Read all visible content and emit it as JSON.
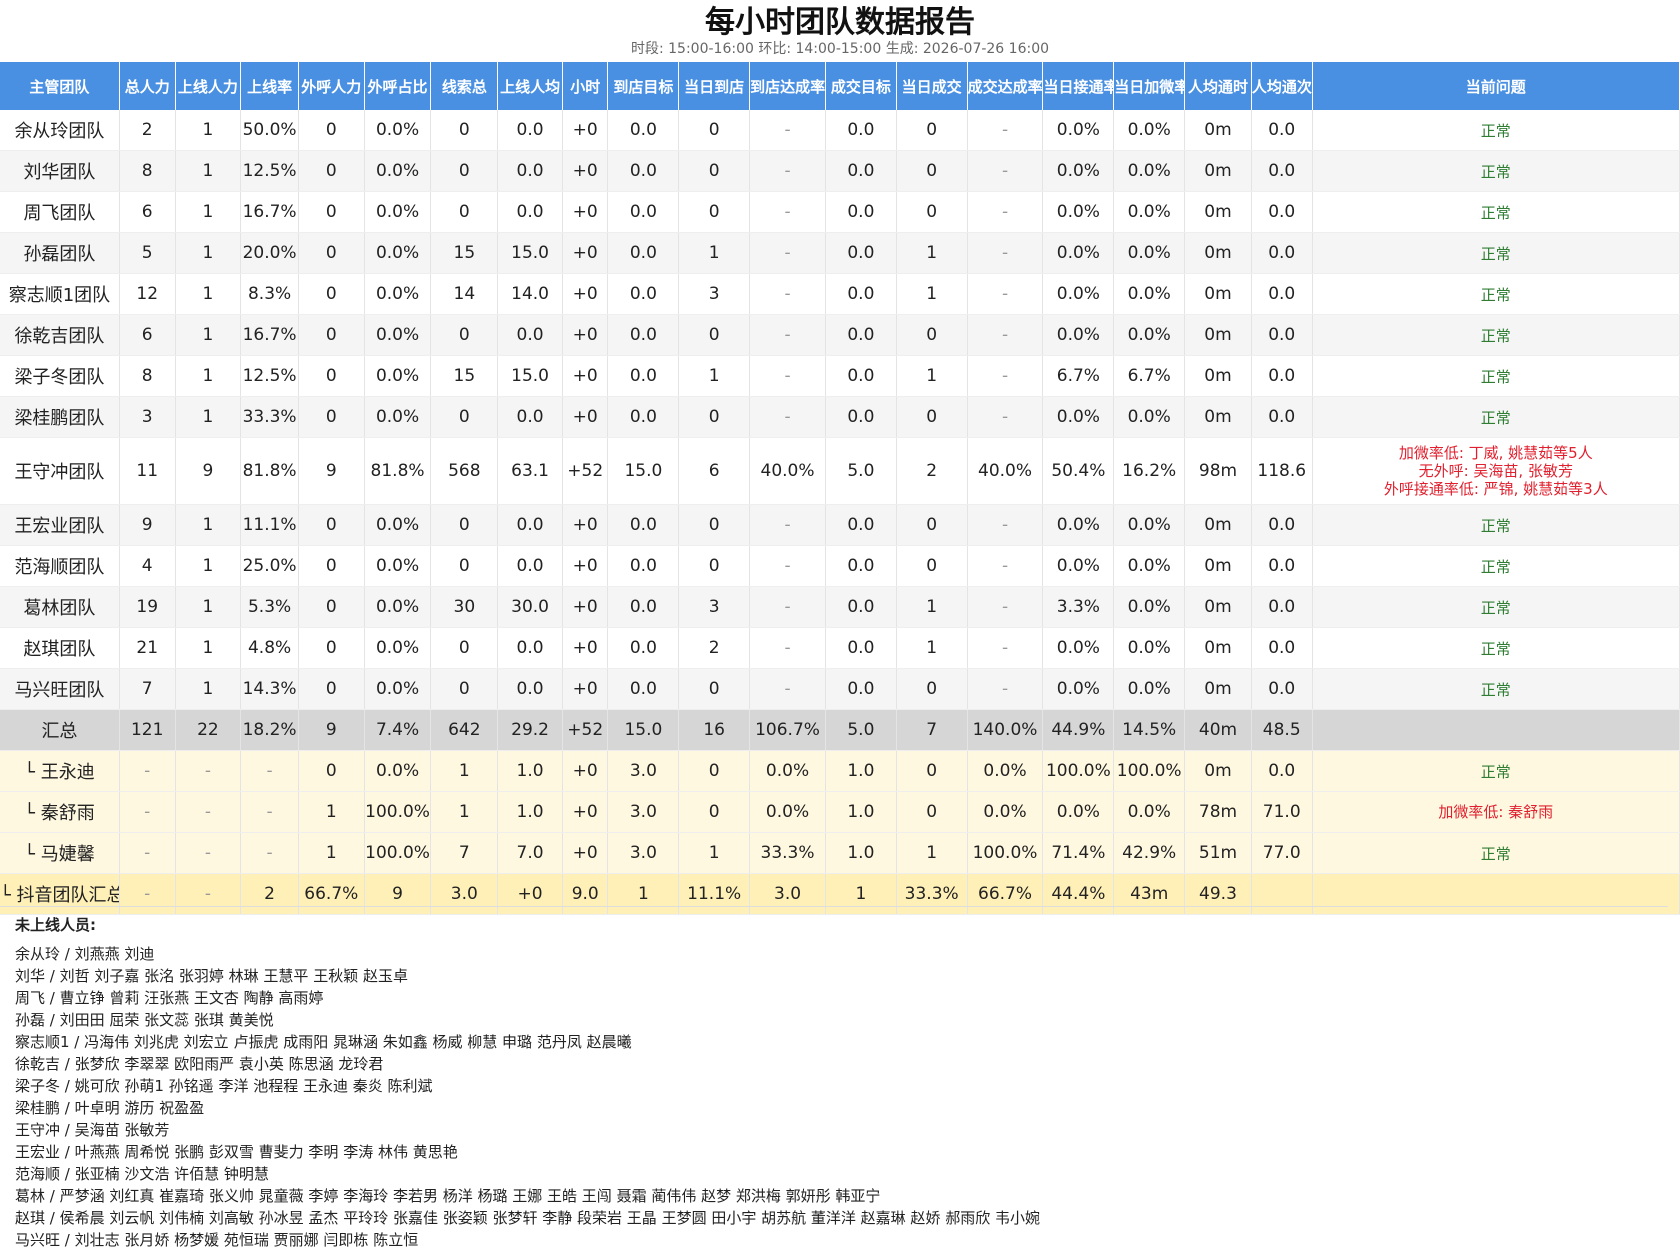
{
  "header": {
    "title": "每小时团队数据报告",
    "subtitle": "时段: 15:00-16:00 环比: 14:00-15:00 生成: 2026-07-26 16:00"
  },
  "columns": [
    "主管团队",
    "总人力",
    "上线人力",
    "上线率",
    "外呼人力",
    "外呼占比",
    "线索总",
    "上线人均",
    "小时",
    "到店目标",
    "当日到店",
    "到店达成率",
    "成交目标",
    "当日成交",
    "成交达成率",
    "当日接通率",
    "当日加微率",
    "人均通时",
    "人均通次",
    "当前问题"
  ],
  "rows": [
    {
      "kind": "team",
      "cells": [
        "余从玲团队",
        "2",
        "1",
        "50.0%",
        "0",
        "0.0%",
        "0",
        "0.0",
        "+0",
        "0.0",
        "0",
        "-",
        "0.0",
        "0",
        "-",
        "0.0%",
        "0.0%",
        "0m",
        "0.0"
      ],
      "status": [
        "正常"
      ],
      "status_type": "ok"
    },
    {
      "kind": "team",
      "cells": [
        "刘华团队",
        "8",
        "1",
        "12.5%",
        "0",
        "0.0%",
        "0",
        "0.0",
        "+0",
        "0.0",
        "0",
        "-",
        "0.0",
        "0",
        "-",
        "0.0%",
        "0.0%",
        "0m",
        "0.0"
      ],
      "status": [
        "正常"
      ],
      "status_type": "ok"
    },
    {
      "kind": "team",
      "cells": [
        "周飞团队",
        "6",
        "1",
        "16.7%",
        "0",
        "0.0%",
        "0",
        "0.0",
        "+0",
        "0.0",
        "0",
        "-",
        "0.0",
        "0",
        "-",
        "0.0%",
        "0.0%",
        "0m",
        "0.0"
      ],
      "status": [
        "正常"
      ],
      "status_type": "ok"
    },
    {
      "kind": "team",
      "cells": [
        "孙磊团队",
        "5",
        "1",
        "20.0%",
        "0",
        "0.0%",
        "15",
        "15.0",
        "+0",
        "0.0",
        "1",
        "-",
        "0.0",
        "1",
        "-",
        "0.0%",
        "0.0%",
        "0m",
        "0.0"
      ],
      "status": [
        "正常"
      ],
      "status_type": "ok"
    },
    {
      "kind": "team",
      "cells": [
        "察志顺1团队",
        "12",
        "1",
        "8.3%",
        "0",
        "0.0%",
        "14",
        "14.0",
        "+0",
        "0.0",
        "3",
        "-",
        "0.0",
        "1",
        "-",
        "0.0%",
        "0.0%",
        "0m",
        "0.0"
      ],
      "status": [
        "正常"
      ],
      "status_type": "ok"
    },
    {
      "kind": "team",
      "cells": [
        "徐乾吉团队",
        "6",
        "1",
        "16.7%",
        "0",
        "0.0%",
        "0",
        "0.0",
        "+0",
        "0.0",
        "0",
        "-",
        "0.0",
        "0",
        "-",
        "0.0%",
        "0.0%",
        "0m",
        "0.0"
      ],
      "status": [
        "正常"
      ],
      "status_type": "ok"
    },
    {
      "kind": "team",
      "cells": [
        "梁子冬团队",
        "8",
        "1",
        "12.5%",
        "0",
        "0.0%",
        "15",
        "15.0",
        "+0",
        "0.0",
        "1",
        "-",
        "0.0",
        "1",
        "-",
        "6.7%",
        "6.7%",
        "0m",
        "0.0"
      ],
      "status": [
        "正常"
      ],
      "status_type": "ok"
    },
    {
      "kind": "team",
      "cells": [
        "梁桂鹏团队",
        "3",
        "1",
        "33.3%",
        "0",
        "0.0%",
        "0",
        "0.0",
        "+0",
        "0.0",
        "0",
        "-",
        "0.0",
        "0",
        "-",
        "0.0%",
        "0.0%",
        "0m",
        "0.0"
      ],
      "status": [
        "正常"
      ],
      "status_type": "ok"
    },
    {
      "kind": "team",
      "tall": true,
      "cells": [
        "王守冲团队",
        "11",
        "9",
        "81.8%",
        "9",
        "81.8%",
        "568",
        "63.1",
        "+52",
        "15.0",
        "6",
        "40.0%",
        "5.0",
        "2",
        "40.0%",
        "50.4%",
        "16.2%",
        "98m",
        "118.6"
      ],
      "status": [
        "加微率低: 丁威, 姚慧茹等5人",
        "无外呼: 吴海苗, 张敏芳",
        "外呼接通率低: 严锦, 姚慧茹等3人"
      ],
      "status_type": "bad"
    },
    {
      "kind": "team",
      "cells": [
        "王宏业团队",
        "9",
        "1",
        "11.1%",
        "0",
        "0.0%",
        "0",
        "0.0",
        "+0",
        "0.0",
        "0",
        "-",
        "0.0",
        "0",
        "-",
        "0.0%",
        "0.0%",
        "0m",
        "0.0"
      ],
      "status": [
        "正常"
      ],
      "status_type": "ok"
    },
    {
      "kind": "team",
      "cells": [
        "范海顺团队",
        "4",
        "1",
        "25.0%",
        "0",
        "0.0%",
        "0",
        "0.0",
        "+0",
        "0.0",
        "0",
        "-",
        "0.0",
        "0",
        "-",
        "0.0%",
        "0.0%",
        "0m",
        "0.0"
      ],
      "status": [
        "正常"
      ],
      "status_type": "ok"
    },
    {
      "kind": "team",
      "cells": [
        "葛林团队",
        "19",
        "1",
        "5.3%",
        "0",
        "0.0%",
        "30",
        "30.0",
        "+0",
        "0.0",
        "3",
        "-",
        "0.0",
        "1",
        "-",
        "3.3%",
        "0.0%",
        "0m",
        "0.0"
      ],
      "status": [
        "正常"
      ],
      "status_type": "ok"
    },
    {
      "kind": "team",
      "cells": [
        "赵琪团队",
        "21",
        "1",
        "4.8%",
        "0",
        "0.0%",
        "0",
        "0.0",
        "+0",
        "0.0",
        "2",
        "-",
        "0.0",
        "1",
        "-",
        "0.0%",
        "0.0%",
        "0m",
        "0.0"
      ],
      "status": [
        "正常"
      ],
      "status_type": "ok"
    },
    {
      "kind": "team",
      "cells": [
        "马兴旺团队",
        "7",
        "1",
        "14.3%",
        "0",
        "0.0%",
        "0",
        "0.0",
        "+0",
        "0.0",
        "0",
        "-",
        "0.0",
        "0",
        "-",
        "0.0%",
        "0.0%",
        "0m",
        "0.0"
      ],
      "status": [
        "正常"
      ],
      "status_type": "ok"
    },
    {
      "kind": "total",
      "cells": [
        "汇总",
        "121",
        "22",
        "18.2%",
        "9",
        "7.4%",
        "642",
        "29.2",
        "+52",
        "15.0",
        "16",
        "106.7%",
        "5.0",
        "7",
        "140.0%",
        "44.9%",
        "14.5%",
        "40m",
        "48.5"
      ],
      "status": [],
      "status_type": "none"
    },
    {
      "kind": "sub",
      "cells": [
        "└ 王永迪",
        "-",
        "-",
        "-",
        "0",
        "0.0%",
        "1",
        "1.0",
        "+0",
        "3.0",
        "0",
        "0.0%",
        "1.0",
        "0",
        "0.0%",
        "100.0%",
        "100.0%",
        "0m",
        "0.0"
      ],
      "status": [
        "正常"
      ],
      "status_type": "ok"
    },
    {
      "kind": "sub",
      "cells": [
        "└ 秦舒雨",
        "-",
        "-",
        "-",
        "1",
        "100.0%",
        "1",
        "1.0",
        "+0",
        "3.0",
        "0",
        "0.0%",
        "1.0",
        "0",
        "0.0%",
        "0.0%",
        "0.0%",
        "78m",
        "71.0"
      ],
      "status": [
        "加微率低: 秦舒雨"
      ],
      "status_type": "bad"
    },
    {
      "kind": "sub",
      "cells": [
        "└ 马婕馨",
        "-",
        "-",
        "-",
        "1",
        "100.0%",
        "7",
        "7.0",
        "+0",
        "3.0",
        "1",
        "33.3%",
        "1.0",
        "1",
        "100.0%",
        "71.4%",
        "42.9%",
        "51m",
        "77.0"
      ],
      "status": [
        "正常"
      ],
      "status_type": "ok"
    },
    {
      "kind": "subtotal",
      "cells": [
        "└ 抖音团队汇总 -",
        "-",
        "-",
        "2",
        "66.7%",
        "9",
        "3.0",
        "+0",
        "9.0",
        "1",
        "11.1%",
        "3.0",
        "1",
        "33.3%",
        "66.7%",
        "44.4%",
        "43m",
        "49.3"
      ],
      "status": [],
      "status_type": "none"
    }
  ],
  "offline": {
    "title": "未上线人员:",
    "lines": [
      "余从玲 / 刘燕燕 刘迪",
      "刘华 / 刘哲 刘子嘉 张洺 张羽婷 林琳 王慧平 王秋颖 赵玉卓",
      "周飞 / 曹立铮 曾莉 汪张燕 王文杏 陶静 高雨婷",
      "孙磊 / 刘田田 屈荣 张文蕊 张琪 黄美悦",
      "察志顺1 / 冯海伟 刘兆虎 刘宏立 卢振虎 成雨阳 晁琳涵 朱如鑫 杨威 柳慧 申璐 范丹凤 赵晨曦",
      "徐乾吉 / 张梦欣 李翠翠 欧阳雨严 袁小英 陈思涵 龙玲君",
      "梁子冬 / 姚可欣 孙萌1 孙铭遥 李洋 池程程 王永迪 秦炎 陈利斌",
      "梁桂鹏 / 叶卓明 游历 祝盈盈",
      "王守冲 / 吴海苗 张敏芳",
      "王宏业 / 叶燕燕 周希悦 张鹏 彭双雪 曹斐力 李明 李涛 林伟 黄思艳",
      "范海顺 / 张亚楠 沙文浩 许佰慧 钟明慧",
      "葛林 / 严梦涵 刘红真 崔嘉琦 张义帅 晁童薇 李婷 李海玲 李若男 杨洋 杨璐 王娜 王皓 王闯 聂霜 蔺伟伟 赵梦 郑洪梅 郭妍彤 韩亚宁",
      "赵琪 / 侯希晨 刘云帆 刘伟楠 刘高敏 孙冰昱 孟杰 平玲玲 张嘉佳 张姿颖 张梦轩 李静 段荣岩 王晶 王梦圆 田小宇 胡苏航 董洋洋 赵嘉琳 赵娇 郝雨欣 韦小婉",
      "马兴旺 / 刘壮志 张月娇 杨梦媛 苑恒瑞 贾丽娜 闫即栋 陈立恒"
    ]
  },
  "colors": {
    "header_bg": "#4a90e2",
    "status_ok": "#2e7d32",
    "status_bad": "#e0202e",
    "total_bg": "#d6d6d6",
    "sub_bg": "#fff8e1",
    "subtotal_bg": "#fff0b8"
  }
}
